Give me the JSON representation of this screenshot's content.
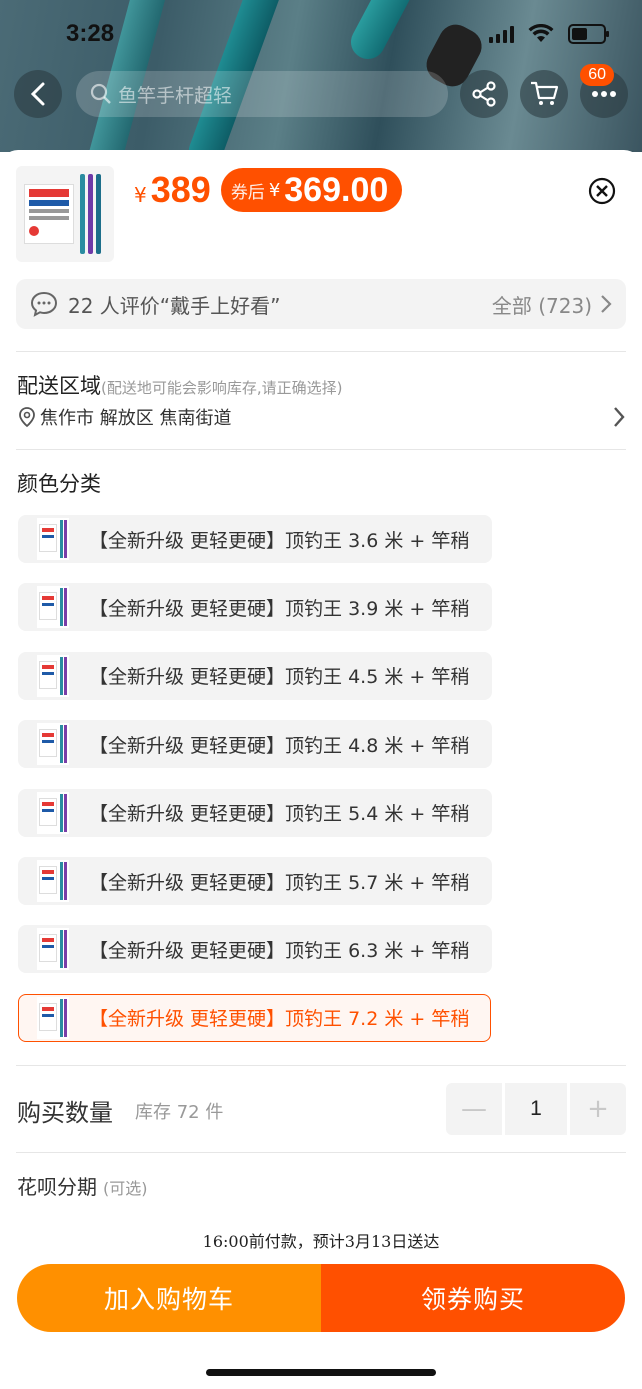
{
  "status_bar": {
    "time": "3:28"
  },
  "nav": {
    "search_placeholder": "鱼竿手杆超轻",
    "cart_badge": "60"
  },
  "product": {
    "price_currency": "¥",
    "price": "389",
    "coupon_label": "券后",
    "coupon_currency": "¥",
    "coupon_price": "369.00"
  },
  "review": {
    "text": "22 人评价“戴手上好看”",
    "all_label": "全部 (723)"
  },
  "delivery": {
    "title": "配送区域",
    "hint": "(配送地可能会影响库存,请正确选择)",
    "address": "焦作市 解放区 焦南街道"
  },
  "variants": {
    "title": "颜色分类",
    "items": [
      {
        "label": "【全新升级 更轻更硬】顶钓王 3.6 米 + 竿稍",
        "selected": false
      },
      {
        "label": "【全新升级 更轻更硬】顶钓王 3.9 米 + 竿稍",
        "selected": false
      },
      {
        "label": "【全新升级 更轻更硬】顶钓王 4.5 米 + 竿稍",
        "selected": false
      },
      {
        "label": "【全新升级 更轻更硬】顶钓王 4.8 米 + 竿稍",
        "selected": false
      },
      {
        "label": "【全新升级 更轻更硬】顶钓王 5.4 米 + 竿稍",
        "selected": false
      },
      {
        "label": "【全新升级 更轻更硬】顶钓王 5.7 米 + 竿稍",
        "selected": false
      },
      {
        "label": "【全新升级 更轻更硬】顶钓王 6.3 米 + 竿稍",
        "selected": false
      },
      {
        "label": "【全新升级 更轻更硬】顶钓王 7.2 米 + 竿稍",
        "selected": true
      }
    ]
  },
  "quantity": {
    "label": "购买数量",
    "stock": "库存 72 件",
    "minus": "—",
    "value": "1",
    "plus": "+"
  },
  "installment": {
    "label": "花呗分期",
    "optional": "(可选)"
  },
  "delivery_note": "16:00前付款，预计3月13日送达",
  "actions": {
    "add_to_cart": "加入购物车",
    "buy": "领券购买"
  },
  "colors": {
    "accent": "#ff5000",
    "cart": "#ff9000"
  }
}
